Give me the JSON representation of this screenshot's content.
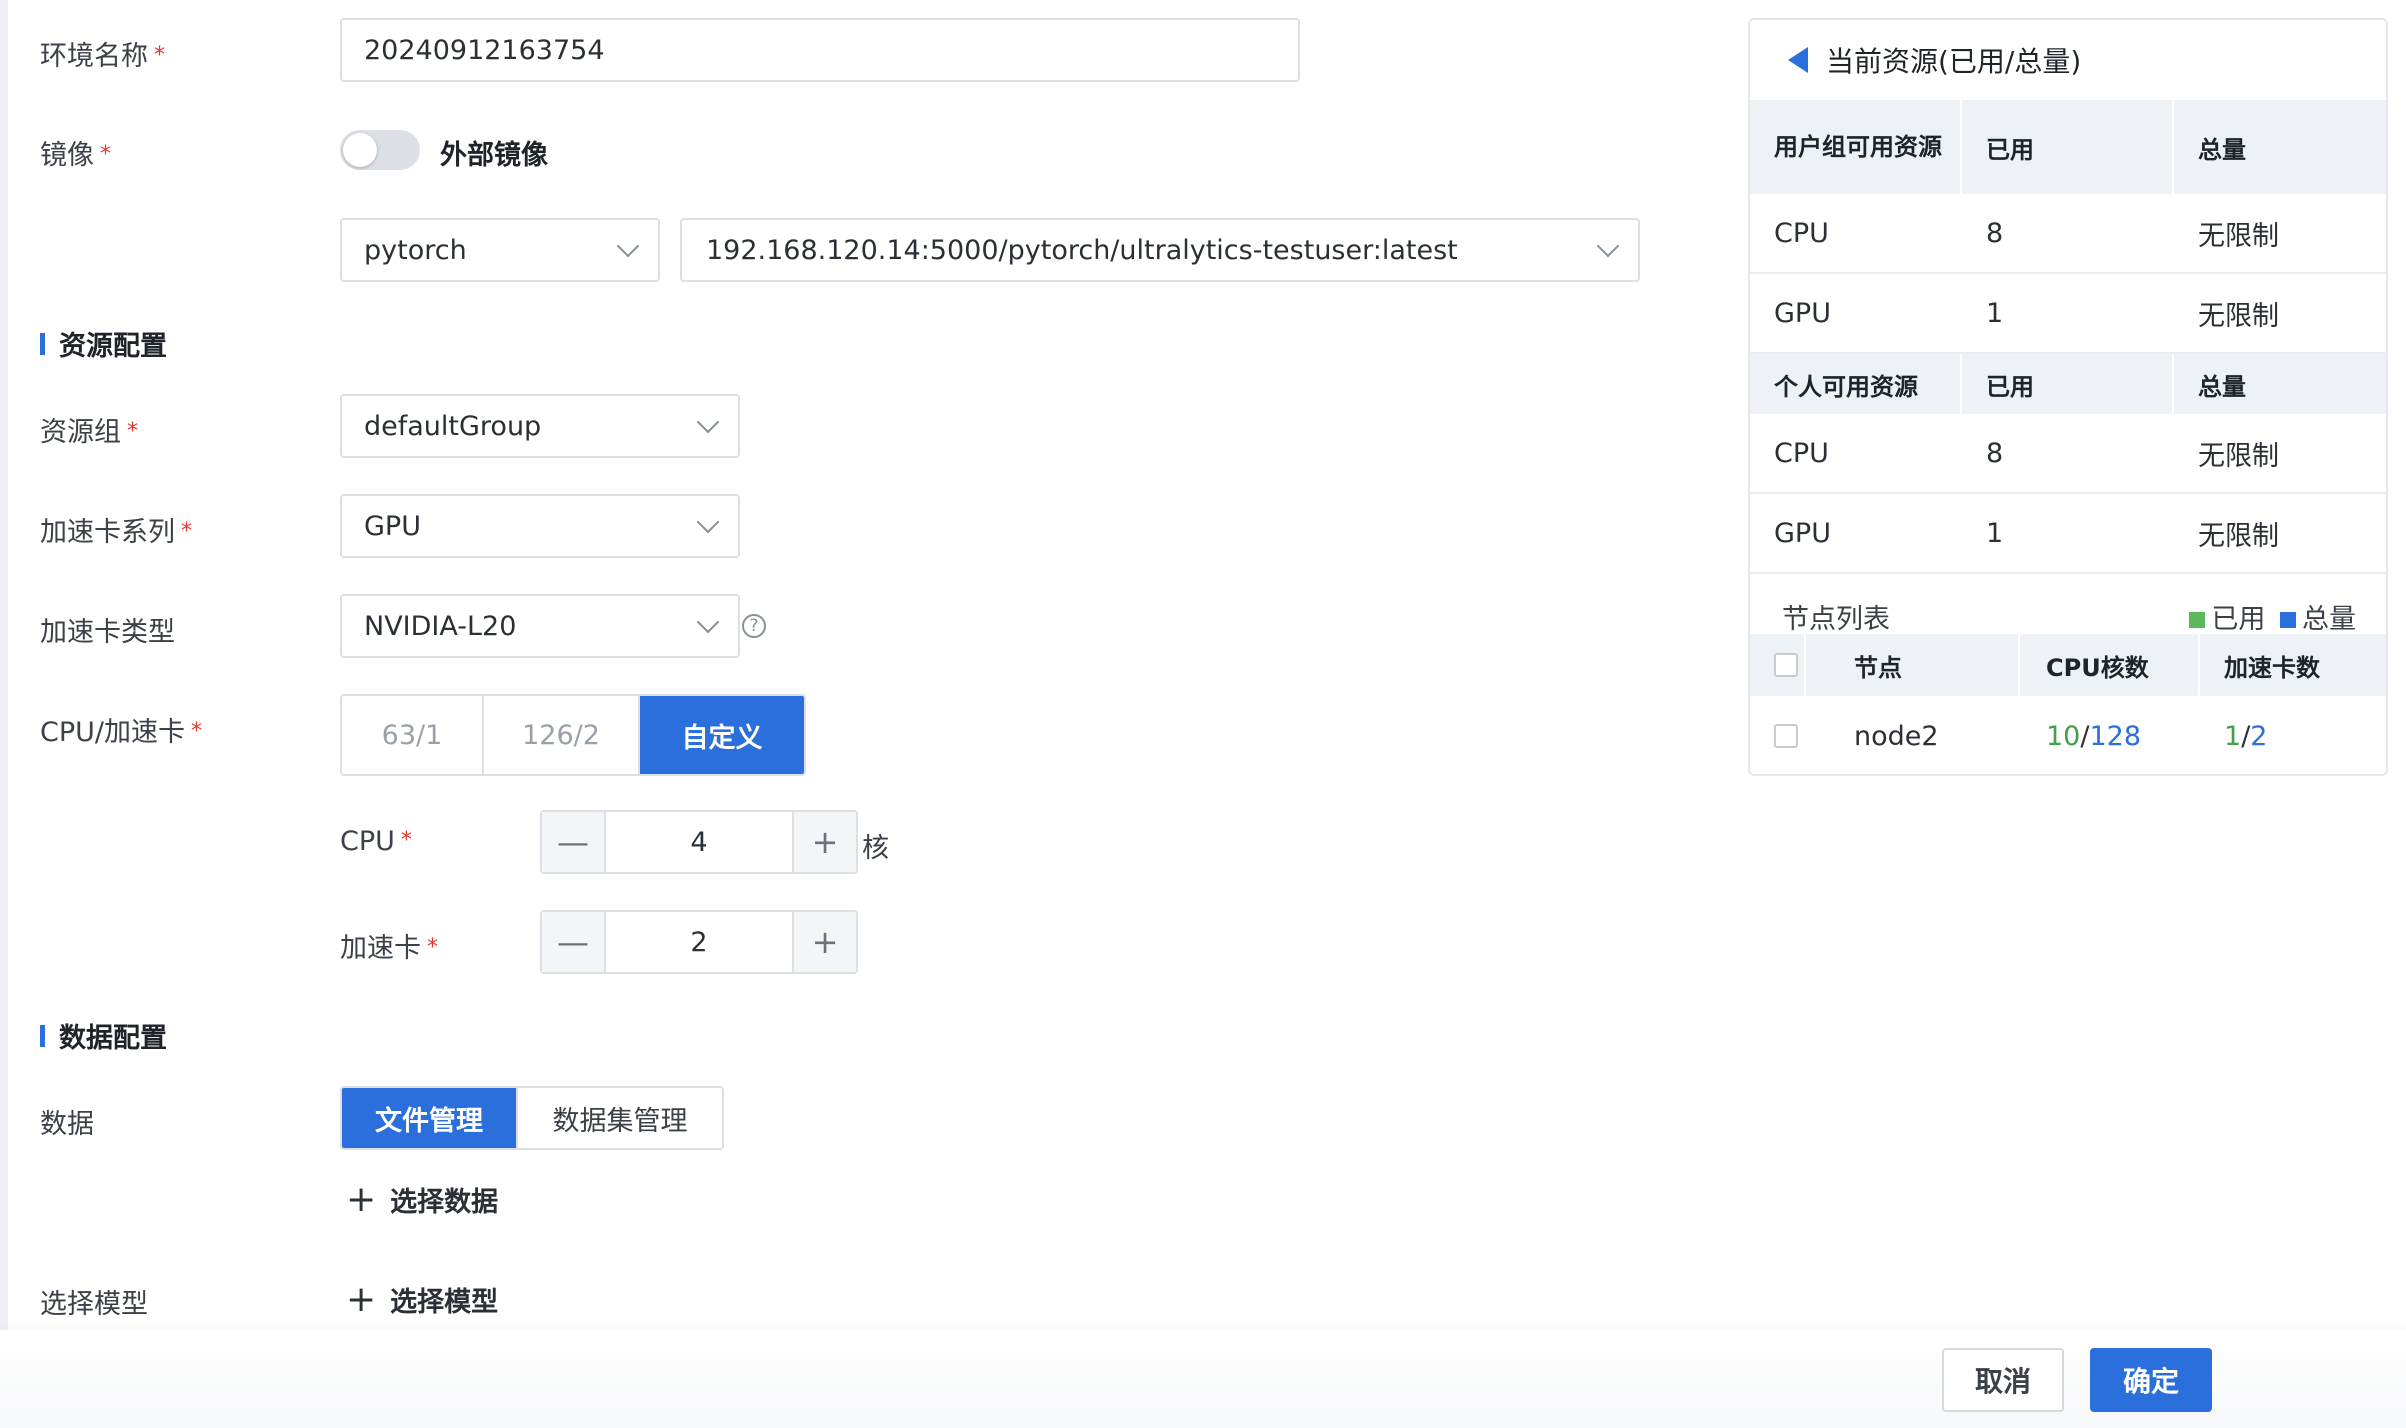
{
  "form": {
    "env_name_label": "环境名称",
    "env_name_value": "20240912163754",
    "image_label": "镜像",
    "external_image_label": "外部镜像",
    "image_framework": "pytorch",
    "image_path": "192.168.120.14:5000/pytorch/ultralytics-testuser:latest",
    "resource_section": "资源配置",
    "resource_group_label": "资源组",
    "resource_group_value": "defaultGroup",
    "accel_series_label": "加速卡系列",
    "accel_series_value": "GPU",
    "accel_type_label": "加速卡类型",
    "accel_type_value": "NVIDIA-L20",
    "cpu_accel_label": "CPU/加速卡",
    "presets": [
      "63/1",
      "126/2",
      "自定义"
    ],
    "cpu_label": "CPU",
    "cpu_value": "4",
    "cpu_unit": "核",
    "accel_label": "加速卡",
    "accel_value": "2",
    "data_section": "数据配置",
    "data_label": "数据",
    "data_tabs": [
      "文件管理",
      "数据集管理"
    ],
    "select_data": "选择数据",
    "model_label": "选择模型",
    "select_model": "选择模型",
    "required_mark": "*",
    "help_mark": "?",
    "minus": "—",
    "plus": "+"
  },
  "panel": {
    "title": "当前资源(已用/总量)",
    "group_header": [
      "用户组可用资源",
      "已用",
      "总量"
    ],
    "group_rows": [
      [
        "CPU",
        "8",
        "无限制"
      ],
      [
        "GPU",
        "1",
        "无限制"
      ]
    ],
    "personal_header": [
      "个人可用资源",
      "已用",
      "总量"
    ],
    "personal_rows": [
      [
        "CPU",
        "8",
        "无限制"
      ],
      [
        "GPU",
        "1",
        "无限制"
      ]
    ],
    "node_list_label": "节点列表",
    "legend_used": "已用",
    "legend_total": "总量",
    "node_header": [
      "节点",
      "CPU核数",
      "加速卡数"
    ],
    "nodes": [
      {
        "name": "node2",
        "cpu_used": "10",
        "cpu_total": "128",
        "accel_used": "1",
        "accel_total": "2"
      }
    ],
    "slash": "/",
    "colors": {
      "used": "#5cb85c",
      "total": "#2a6fdc"
    }
  },
  "footer": {
    "cancel": "取消",
    "confirm": "确定"
  }
}
